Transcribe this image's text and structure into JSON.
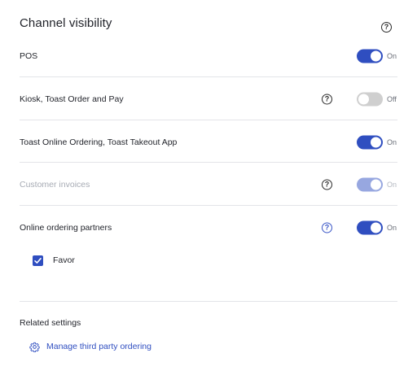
{
  "header": {
    "title": "Channel visibility",
    "help_icon": "question-circle-icon"
  },
  "channels": [
    {
      "label": "POS",
      "state": "On",
      "enabled": true,
      "toggle_on": true,
      "help": false
    },
    {
      "label": "Kiosk, Toast Order and Pay",
      "state": "Off",
      "enabled": true,
      "toggle_on": false,
      "help": true
    },
    {
      "label": "Toast Online Ordering, Toast Takeout App",
      "state": "On",
      "enabled": true,
      "toggle_on": true,
      "help": false
    },
    {
      "label": "Customer invoices",
      "state": "On",
      "enabled": false,
      "toggle_on": true,
      "help": true
    },
    {
      "label": "Online ordering partners",
      "state": "On",
      "enabled": true,
      "toggle_on": true,
      "help": true
    }
  ],
  "partners": [
    {
      "label": "Favor",
      "checked": true
    }
  ],
  "related": {
    "title": "Related settings",
    "link_label": "Manage third party ordering",
    "link_icon": "gear-icon"
  },
  "colors": {
    "accent": "#2f4ec0",
    "toggle_off": "#cfcfcf",
    "toggle_disabled": "#97a7e0",
    "divider": "#e3e4e8"
  }
}
